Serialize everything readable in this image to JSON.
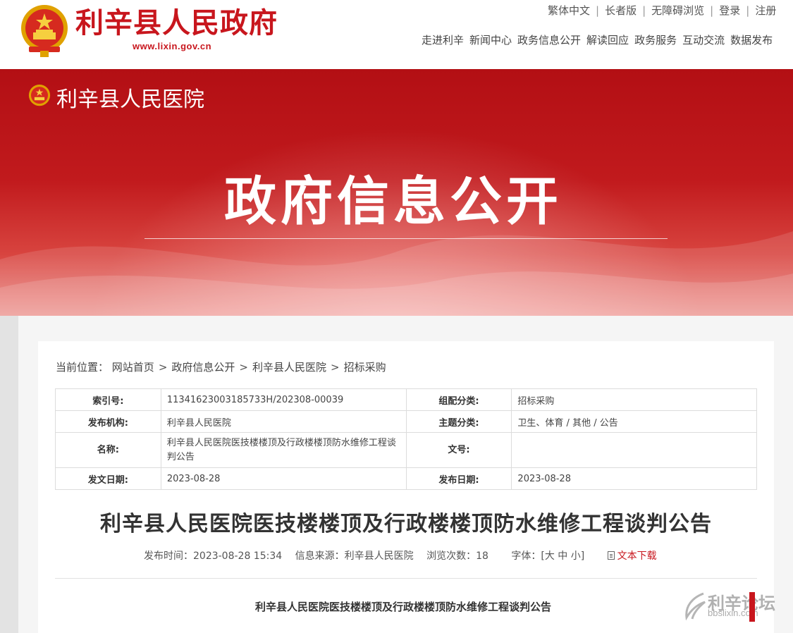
{
  "header": {
    "site_name": "利辛县人民政府",
    "site_url": "www.lixin.gov.cn",
    "util_links": [
      "繁体中文",
      "长者版",
      "无障碍浏览",
      "登录",
      "注册"
    ],
    "nav": [
      "走进利辛",
      "新闻中心",
      "政务信息公开",
      "解读回应",
      "政务服务",
      "互动交流",
      "数据发布"
    ]
  },
  "banner": {
    "org": "利辛县人民医院",
    "title": "政府信息公开"
  },
  "breadcrumb": {
    "prefix": "当前位置：",
    "items": [
      "网站首页",
      "政府信息公开",
      "利辛县人民医院",
      "招标采购"
    ],
    "separator": ">"
  },
  "meta": {
    "index_label": "索引号:",
    "index_value": "11341623003185733H/202308-00039",
    "category_label": "组配分类:",
    "category_value": "招标采购",
    "org_label": "发布机构:",
    "org_value": "利辛县人民医院",
    "topic_label": "主题分类:",
    "topic_value": "卫生、体育 / 其他 / 公告",
    "name_label": "名称:",
    "name_value": "利辛县人民医院医技楼楼顶及行政楼楼顶防水维修工程谈判公告",
    "docno_label": "文号:",
    "docno_value": "",
    "issue_date_label": "发文日期:",
    "issue_date_value": "2023-08-28",
    "publish_date_label": "发布日期:",
    "publish_date_value": "2023-08-28"
  },
  "article": {
    "title": "利辛县人民医院医技楼楼顶及行政楼楼顶防水维修工程谈判公告",
    "time_label": "发布时间：",
    "time_value": "2023-08-28 15:34",
    "source_label": "信息来源：",
    "source_value": "利辛县人民医院",
    "views_label": "浏览次数：",
    "views_value": "18",
    "font_label": "字体：",
    "font_open": "[",
    "font_sizes": [
      "大",
      "中",
      "小"
    ],
    "font_close": "]",
    "download_label": "文本下载",
    "body_heading": "利辛县人民医院医技楼楼顶及行政楼楼顶防水维修工程谈判公告"
  },
  "watermark": {
    "cn": "利辛论坛",
    "en": "bbslixin.com"
  },
  "colors": {
    "brand_red": "#c8161d",
    "banner_red": "#b30f14"
  },
  "icons": {
    "emblem": "national-emblem-icon",
    "download": "document-icon"
  }
}
